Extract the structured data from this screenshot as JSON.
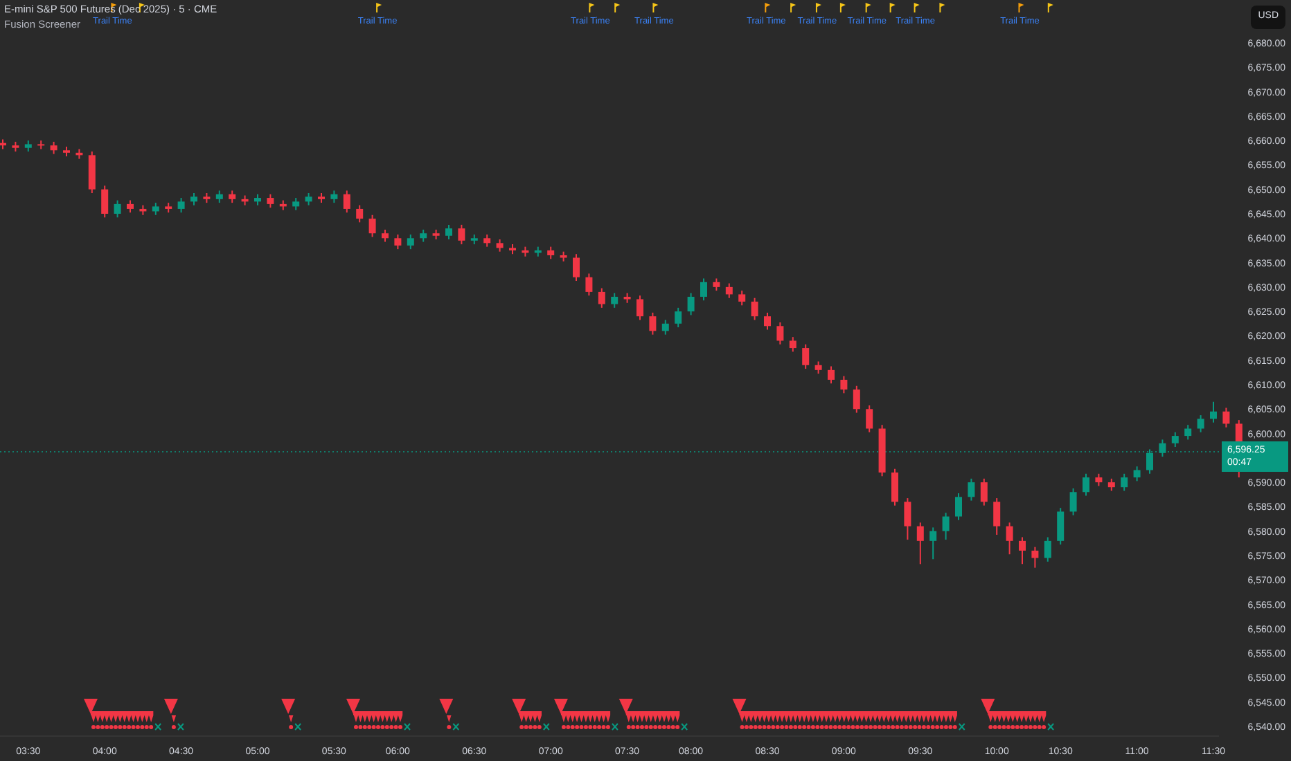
{
  "header": {
    "symbol_title": "E-mini S&P 500 Futures (Dec 2025) · 5 · CME",
    "indicator": "Fusion Screener"
  },
  "currency": "USD",
  "last_price": {
    "price": "6,596.25",
    "countdown": "00:47"
  },
  "chart": {
    "chart_data": {
      "type": "candlestick",
      "ylim": [
        6540,
        6680
      ],
      "categories": [
        null,
        null,
        "03:30",
        null,
        null,
        null,
        null,
        null,
        "04:00",
        null,
        null,
        null,
        null,
        null,
        "04:30",
        null,
        null,
        null,
        null,
        null,
        "05:00",
        null,
        null,
        null,
        null,
        null,
        "05:30",
        null,
        null,
        null,
        null,
        "06:00",
        null,
        null,
        null,
        null,
        null,
        "06:30",
        null,
        null,
        null,
        null,
        null,
        "07:00",
        null,
        null,
        null,
        null,
        null,
        "07:30",
        null,
        null,
        null,
        null,
        "08:00",
        null,
        null,
        null,
        null,
        null,
        "08:30",
        null,
        null,
        null,
        null,
        null,
        "09:00",
        null,
        null,
        null,
        null,
        null,
        "09:30",
        null,
        null,
        null,
        null,
        null,
        "10:00",
        null,
        null,
        null,
        null,
        "10:30",
        null,
        null,
        null,
        null,
        null,
        "11:00",
        null,
        null,
        null,
        null,
        null,
        "11:30",
        null,
        null
      ],
      "ohlc": [
        [
          6659.5,
          6660.25,
          6658.25,
          6659
        ],
        [
          6659,
          6659.75,
          6657.75,
          6658.5
        ],
        [
          6658.5,
          6660,
          6657.75,
          6659.25
        ],
        [
          6659.25,
          6660,
          6658.25,
          6659
        ],
        [
          6659,
          6659.75,
          6657.25,
          6658
        ],
        [
          6658,
          6658.75,
          6656.75,
          6657.5
        ],
        [
          6657.5,
          6658.25,
          6656.25,
          6657
        ],
        [
          6657,
          6657.75,
          6649.25,
          6650
        ],
        [
          6650,
          6650.75,
          6644.25,
          6645
        ],
        [
          6645,
          6647.75,
          6644.25,
          6647
        ],
        [
          6647,
          6647.75,
          6645.25,
          6646
        ],
        [
          6646,
          6646.75,
          6644.75,
          6645.5
        ],
        [
          6645.5,
          6647.25,
          6644.75,
          6646.5
        ],
        [
          6646.5,
          6647.25,
          6645.25,
          6646
        ],
        [
          6646,
          6648.25,
          6645.25,
          6647.5
        ],
        [
          6647.5,
          6649.25,
          6646.75,
          6648.5
        ],
        [
          6648.5,
          6649.25,
          6647.25,
          6648
        ],
        [
          6648,
          6649.75,
          6647.25,
          6649
        ],
        [
          6649,
          6649.75,
          6647.25,
          6648
        ],
        [
          6648,
          6648.75,
          6646.75,
          6647.5
        ],
        [
          6647.5,
          6649,
          6646.75,
          6648.25
        ],
        [
          6648.25,
          6649,
          6646.25,
          6647
        ],
        [
          6647,
          6647.75,
          6645.75,
          6646.5
        ],
        [
          6646.5,
          6648.25,
          6645.75,
          6647.5
        ],
        [
          6647.5,
          6649.25,
          6646.75,
          6648.5
        ],
        [
          6648.5,
          6649.25,
          6647.25,
          6648
        ],
        [
          6648,
          6649.75,
          6647.25,
          6649
        ],
        [
          6649,
          6649.75,
          6645.25,
          6646
        ],
        [
          6646,
          6646.75,
          6643.25,
          6644
        ],
        [
          6644,
          6644.75,
          6640.25,
          6641
        ],
        [
          6641,
          6641.75,
          6639.25,
          6640
        ],
        [
          6640,
          6640.75,
          6637.75,
          6638.5
        ],
        [
          6638.5,
          6640.75,
          6637.75,
          6640
        ],
        [
          6640,
          6641.75,
          6639.25,
          6641
        ],
        [
          6641,
          6641.75,
          6639.75,
          6640.5
        ],
        [
          6640.5,
          6642.75,
          6639.75,
          6642
        ],
        [
          6642,
          6642.75,
          6638.75,
          6639.5
        ],
        [
          6639.5,
          6640.75,
          6638.75,
          6640
        ],
        [
          6640,
          6640.75,
          6638.25,
          6639
        ],
        [
          6639,
          6639.75,
          6637.25,
          6638
        ],
        [
          6638,
          6638.75,
          6636.75,
          6637.5
        ],
        [
          6637.5,
          6638.25,
          6636.25,
          6637
        ],
        [
          6637,
          6638.25,
          6636.25,
          6637.5
        ],
        [
          6637.5,
          6638.25,
          6635.75,
          6636.5
        ],
        [
          6636.5,
          6637.25,
          6635.25,
          6636
        ],
        [
          6636,
          6636.75,
          6631.25,
          6632
        ],
        [
          6632,
          6632.75,
          6628.25,
          6629
        ],
        [
          6629,
          6629.75,
          6625.75,
          6626.5
        ],
        [
          6626.5,
          6628.75,
          6625.75,
          6628
        ],
        [
          6628,
          6628.75,
          6626.75,
          6627.5
        ],
        [
          6627.5,
          6628.25,
          6623.25,
          6624
        ],
        [
          6624,
          6624.75,
          6620.25,
          6621
        ],
        [
          6621,
          6623.25,
          6620.25,
          6622.5
        ],
        [
          6622.5,
          6625.75,
          6621.75,
          6625
        ],
        [
          6625,
          6628.75,
          6624.25,
          6628
        ],
        [
          6628,
          6631.75,
          6627.25,
          6631
        ],
        [
          6631,
          6631.75,
          6629.25,
          6630
        ],
        [
          6630,
          6630.75,
          6627.75,
          6628.5
        ],
        [
          6628.5,
          6629.25,
          6626.25,
          6627
        ],
        [
          6627,
          6627.75,
          6623.25,
          6624
        ],
        [
          6624,
          6624.75,
          6621.25,
          6622
        ],
        [
          6622,
          6622.75,
          6618.25,
          6619
        ],
        [
          6619,
          6619.75,
          6616.75,
          6617.5
        ],
        [
          6617.5,
          6618.25,
          6613.25,
          6614
        ],
        [
          6614,
          6614.75,
          6612.25,
          6613
        ],
        [
          6613,
          6613.75,
          6610.25,
          6611
        ],
        [
          6611,
          6611.75,
          6608.25,
          6609
        ],
        [
          6609,
          6609.75,
          6604.25,
          6605
        ],
        [
          6605,
          6605.75,
          6600.25,
          6601
        ],
        [
          6601,
          6601.75,
          6591.25,
          6592
        ],
        [
          6592,
          6592.75,
          6585.25,
          6586
        ],
        [
          6586,
          6586.75,
          6578.25,
          6581
        ],
        [
          6581,
          6581.75,
          6573.25,
          6578
        ],
        [
          6578,
          6580.75,
          6574.25,
          6580
        ],
        [
          6580,
          6583.75,
          6578.25,
          6583
        ],
        [
          6583,
          6587.75,
          6582.25,
          6587
        ],
        [
          6587,
          6590.75,
          6586.25,
          6590
        ],
        [
          6590,
          6590.75,
          6585.25,
          6586
        ],
        [
          6586,
          6586.75,
          6579.25,
          6581
        ],
        [
          6581,
          6581.75,
          6575.25,
          6578
        ],
        [
          6578,
          6578.75,
          6573.25,
          6576
        ],
        [
          6576,
          6576.75,
          6572.5,
          6574.5
        ],
        [
          6574.5,
          6578.75,
          6573.75,
          6578
        ],
        [
          6578,
          6584.75,
          6577.25,
          6584
        ],
        [
          6584,
          6588.75,
          6583.25,
          6588
        ],
        [
          6588,
          6591.75,
          6587.25,
          6591
        ],
        [
          6591,
          6591.75,
          6589.25,
          6590
        ],
        [
          6590,
          6590.75,
          6588.25,
          6589
        ],
        [
          6589,
          6591.75,
          6588.25,
          6591
        ],
        [
          6591,
          6593.25,
          6590.25,
          6592.5
        ],
        [
          6592.5,
          6596.75,
          6591.75,
          6596
        ],
        [
          6596,
          6598.75,
          6595.25,
          6598
        ],
        [
          6598,
          6600.25,
          6597.25,
          6599.5
        ],
        [
          6599.5,
          6601.75,
          6598.75,
          6601
        ],
        [
          6601,
          6603.75,
          6600.25,
          6603
        ],
        [
          6603,
          6606.5,
          6602.25,
          6604.5
        ],
        [
          6604.5,
          6605.25,
          6601.25,
          6602
        ],
        [
          6602,
          6602.75,
          6591,
          6596.25
        ]
      ],
      "yticks": [
        {
          "value": 6680,
          "label": "6,680.00"
        },
        {
          "value": 6675,
          "label": "6,675.00"
        },
        {
          "value": 6670,
          "label": "6,670.00"
        },
        {
          "value": 6665,
          "label": "6,665.00"
        },
        {
          "value": 6660,
          "label": "6,660.00"
        },
        {
          "value": 6655,
          "label": "6,655.00"
        },
        {
          "value": 6650,
          "label": "6,650.00"
        },
        {
          "value": 6645,
          "label": "6,645.00"
        },
        {
          "value": 6640,
          "label": "6,640.00"
        },
        {
          "value": 6635,
          "label": "6,635.00"
        },
        {
          "value": 6630,
          "label": "6,630.00"
        },
        {
          "value": 6625,
          "label": "6,625.00"
        },
        {
          "value": 6620,
          "label": "6,620.00"
        },
        {
          "value": 6615,
          "label": "6,615.00"
        },
        {
          "value": 6610,
          "label": "6,610.00"
        },
        {
          "value": 6605,
          "label": "6,605.00"
        },
        {
          "value": 6600,
          "label": "6,600.00"
        },
        {
          "value": 6590,
          "label": "6,590.00"
        },
        {
          "value": 6585,
          "label": "6,585.00"
        },
        {
          "value": 6580,
          "label": "6,580.00"
        },
        {
          "value": 6575,
          "label": "6,575.00"
        },
        {
          "value": 6570,
          "label": "6,570.00"
        },
        {
          "value": 6565,
          "label": "6,565.00"
        },
        {
          "value": 6560,
          "label": "6,560.00"
        },
        {
          "value": 6555,
          "label": "6,555.00"
        },
        {
          "value": 6550,
          "label": "6,550.00"
        },
        {
          "value": 6545,
          "label": "6,545.00"
        },
        {
          "value": 6540,
          "label": "6,540.00"
        }
      ],
      "ref_lines": [
        {
          "axis": "y",
          "value": 6596.25
        }
      ]
    }
  },
  "flag_markers": [
    {
      "color": "#f59e0b",
      "label": "Trail Time"
    },
    {
      "color": "#f5c518"
    },
    {
      "color": "#f5c518",
      "label": "Trail Time"
    },
    {
      "color": "#f5c518",
      "label": "Trail Time"
    },
    {
      "color": "#f5c518"
    },
    {
      "color": "#f5c518",
      "label": "Trail Time"
    },
    {
      "color": "#f59e0b",
      "label": "Trail Time"
    },
    {
      "color": "#f5c518"
    },
    {
      "color": "#f5c518",
      "label": "Trail Time"
    },
    {
      "color": "#f5c518"
    },
    {
      "color": "#f5c518",
      "label": "Trail Time"
    },
    {
      "color": "#f5c518"
    },
    {
      "color": "#f5c518",
      "label": "Trail Time"
    },
    {
      "color": "#f5c518"
    },
    {
      "color": "#f59e0b",
      "label": "Trail Time"
    },
    {
      "color": "#f5c518"
    }
  ],
  "signal_markers": [
    {
      "kind": "sell"
    },
    {
      "kind": "sell"
    },
    {
      "kind": "sell"
    },
    {
      "kind": "sell"
    },
    {
      "kind": "sell"
    },
    {
      "kind": "sell"
    },
    {
      "kind": "sell"
    },
    {
      "kind": "sell"
    },
    {
      "kind": "sell"
    },
    {
      "kind": "sell"
    }
  ]
}
